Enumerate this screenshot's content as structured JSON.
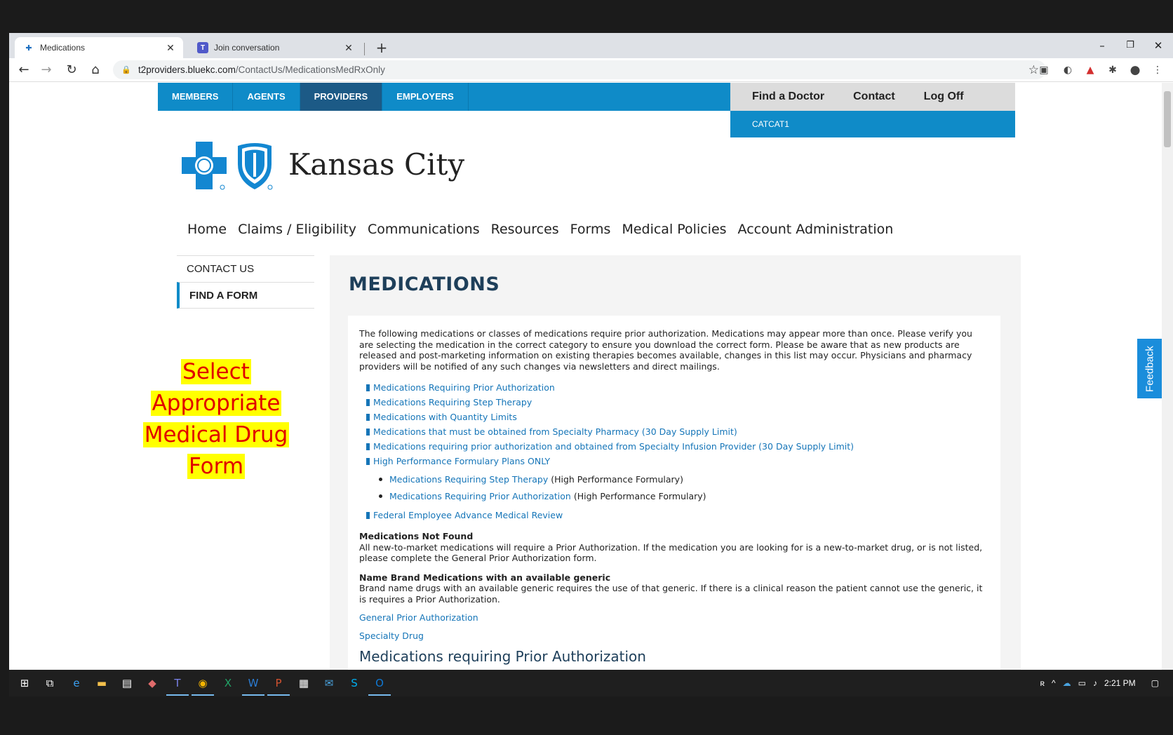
{
  "browser": {
    "tabs": [
      {
        "title": "Medications",
        "icon": "bluekc-icon"
      },
      {
        "title": "Join conversation",
        "icon": "teams-icon"
      }
    ],
    "url_host": "t2providers.bluekc.com",
    "url_path": "/ContactUs/MedicationsMedRxOnly"
  },
  "topnav": {
    "items": [
      "MEMBERS",
      "AGENTS",
      "PROVIDERS",
      "EMPLOYERS"
    ],
    "active": "PROVIDERS"
  },
  "userpanel": {
    "links": [
      "Find a Doctor",
      "Contact",
      "Log Off"
    ],
    "username": "CATCAT1"
  },
  "logo": {
    "name": "Kansas City"
  },
  "mainnav": [
    "Home",
    "Claims / Eligibility",
    "Communications",
    "Resources",
    "Forms",
    "Medical Policies",
    "Account Administration"
  ],
  "sidenav": [
    "CONTACT US",
    "FIND A FORM"
  ],
  "annotation": [
    "Select",
    "Appropriate",
    "Medical Drug",
    "Form"
  ],
  "content": {
    "title": "MEDICATIONS",
    "intro": "The following medications or classes of medications require prior authorization. Medications may appear more than once. Please verify you are selecting the medication in the correct category to ensure you download the correct form. Please be aware that as new products are released and post-marketing information on existing therapies becomes available, changes in this list may occur. Physicians and pharmacy providers will be notified of any such changes via newsletters and direct mailings.",
    "links": [
      "Medications Requiring Prior Authorization",
      "Medications Requiring Step Therapy",
      "Medications with Quantity Limits",
      "Medications that must be obtained from Specialty Pharmacy (30 Day Supply Limit)",
      "Medications requiring prior authorization and obtained from Specialty Infusion Provider (30 Day Supply Limit)",
      "High Performance Formulary Plans ONLY"
    ],
    "sublinks": [
      {
        "link": "Medications Requiring Step Therapy",
        "suffix": " (High Performance Formulary)"
      },
      {
        "link": "Medications Requiring Prior Authorization",
        "suffix": " (High Performance Formulary)"
      }
    ],
    "fed_link": "Federal Employee Advance Medical Review",
    "not_found_heading": "Medications Not Found",
    "not_found_text": "All new-to-market medications will require a Prior Authorization. If the medication you are looking for is a new-to-market drug, or is not listed, please complete the General Prior Authorization form.",
    "brand_heading": "Name Brand Medications with an available generic",
    "brand_text": "Brand name drugs with an available generic requires the use of that generic. If there is a clinical reason the patient cannot use the generic, it is requires a Prior Authorization.",
    "general_link": "General Prior Authorization",
    "specialty_link": "Specialty Drug",
    "bottom_heading": "Medications requiring Prior Authorization"
  },
  "feedback": "Feedback",
  "taskbar": {
    "time": "2:21 PM"
  }
}
